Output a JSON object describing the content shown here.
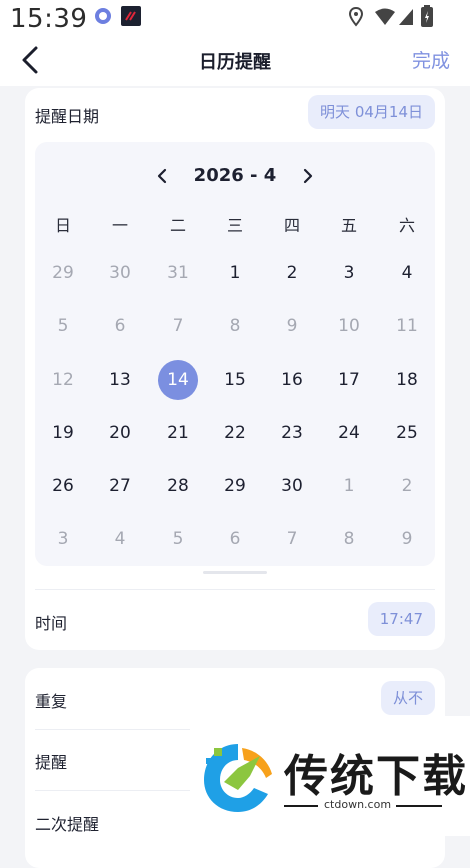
{
  "status_bar": {
    "time": "15:39"
  },
  "nav": {
    "title": "日历提醒",
    "done_label": "完成"
  },
  "date_row": {
    "label": "提醒日期",
    "value": "明天 04月14日"
  },
  "calendar": {
    "year": "2026",
    "month": "4",
    "weekdays": [
      "日",
      "一",
      "二",
      "三",
      "四",
      "五",
      "六"
    ],
    "weeks": [
      [
        "29",
        "30",
        "31",
        "1",
        "2",
        "3",
        "4"
      ],
      [
        "5",
        "6",
        "7",
        "8",
        "9",
        "10",
        "11"
      ],
      [
        "12",
        "13",
        "14",
        "15",
        "16",
        "17",
        "18"
      ],
      [
        "19",
        "20",
        "21",
        "22",
        "23",
        "24",
        "25"
      ],
      [
        "26",
        "27",
        "28",
        "29",
        "30",
        "1",
        "2"
      ],
      [
        "3",
        "4",
        "5",
        "6",
        "7",
        "8",
        "9"
      ]
    ],
    "selected_day": "14",
    "colors": {
      "selected": "#7b8fe0",
      "muted": "#a5a8b2"
    }
  },
  "time_row": {
    "label": "时间",
    "value": "17:47"
  },
  "repeat_row": {
    "label": "重复",
    "value": "从不"
  },
  "remind_row": {
    "label": "提醒"
  },
  "second_remind_row": {
    "label": "二次提醒"
  },
  "watermark": {
    "title": "传统下载",
    "url": "ctdown.com"
  },
  "accent_color": "#7e90d8"
}
